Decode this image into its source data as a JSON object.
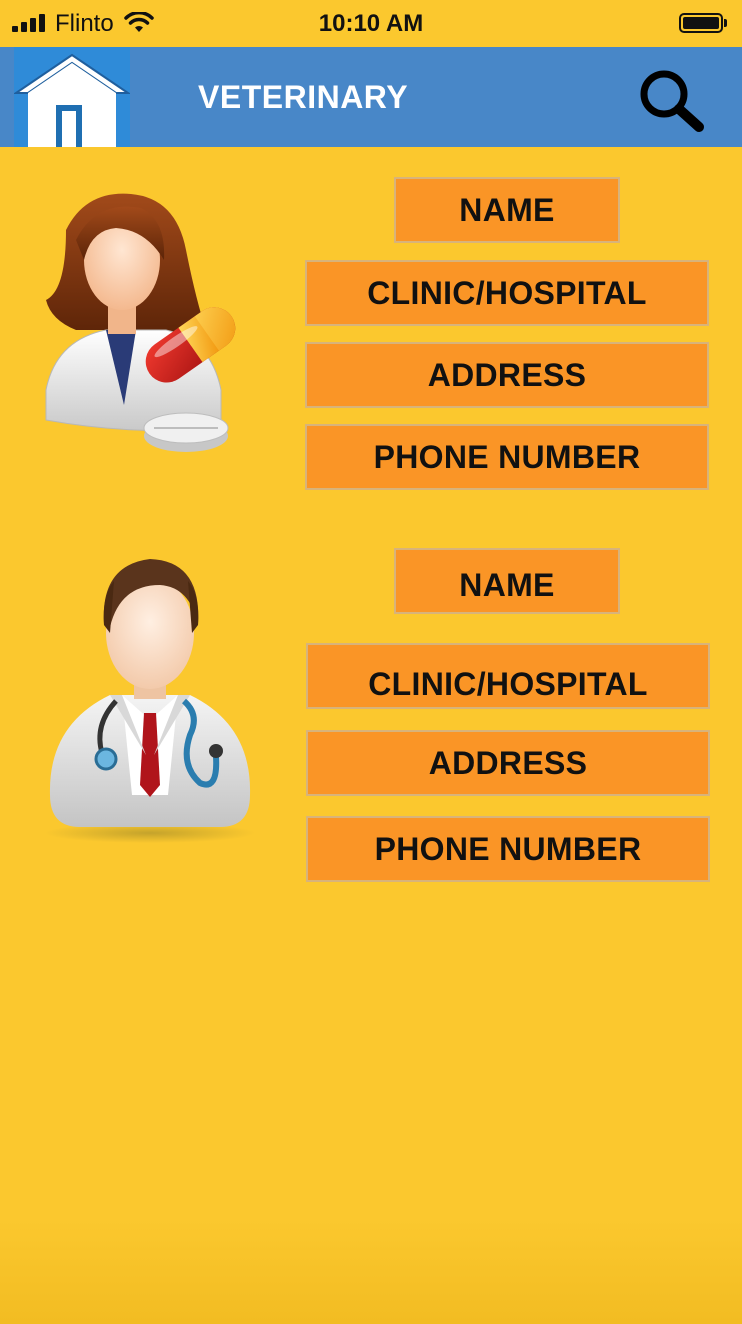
{
  "status_bar": {
    "carrier": "Flinto",
    "time": "10:10 AM"
  },
  "header": {
    "title": "VETERINARY",
    "home_icon": "home-icon",
    "search_icon": "search-icon"
  },
  "vets": [
    {
      "avatar": "female-doctor-with-pills-icon",
      "name_label": "NAME",
      "clinic_label": "CLINIC/HOSPITAL",
      "address_label": "ADDRESS",
      "phone_label": "PHONE NUMBER"
    },
    {
      "avatar": "male-doctor-with-stethoscope-icon",
      "name_label": "NAME",
      "clinic_label": "CLINIC/HOSPITAL",
      "address_label": "ADDRESS",
      "phone_label": "PHONE NUMBER"
    }
  ],
  "colors": {
    "background": "#FBC82E",
    "header": "#4887C8",
    "button": "#FA9526",
    "title_text": "#FFFFFF"
  }
}
